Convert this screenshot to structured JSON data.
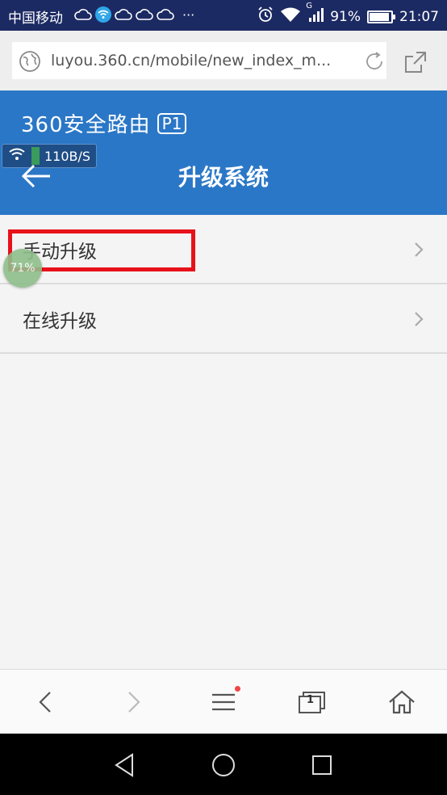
{
  "status_bar": {
    "carrier": "中国移动",
    "dots": "···",
    "signal_type": "G",
    "battery": "91%",
    "battery_level": 0.91,
    "time": "21:07"
  },
  "browser": {
    "url": "luyou.360.cn/mobile/new_index_m...",
    "tab_count": "1"
  },
  "header": {
    "brand": "360安全路由",
    "badge": "P1",
    "speed": "110B/S",
    "title": "升级系统"
  },
  "menu": {
    "items": [
      {
        "label": "手动升级"
      },
      {
        "label": "在线升级"
      }
    ]
  },
  "float_ball": {
    "label": "71%"
  },
  "colors": {
    "header_bg": "#2b77c7",
    "status_bg": "#1c2a63",
    "highlight": "#e8111a"
  }
}
